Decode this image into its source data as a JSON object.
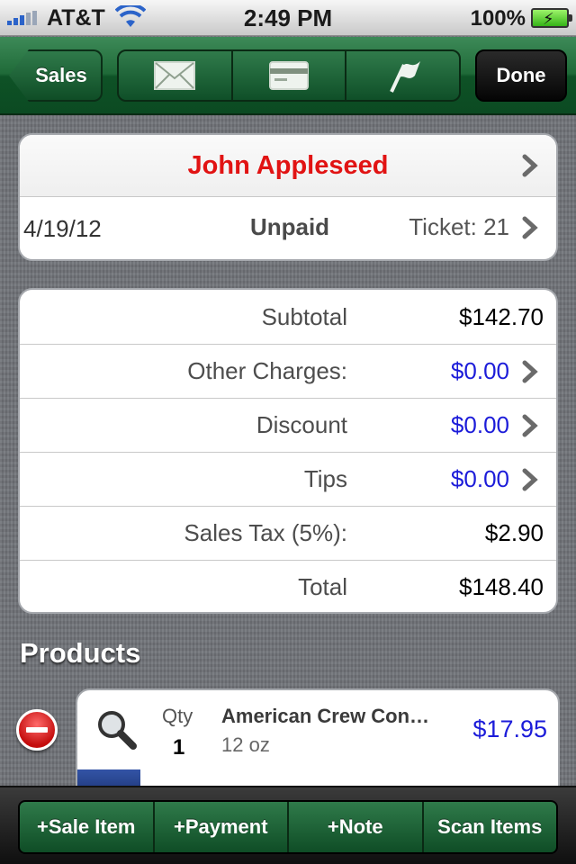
{
  "status_bar": {
    "carrier": "AT&T",
    "time": "2:49 PM",
    "battery": "100%"
  },
  "toolbar": {
    "back_label": "Sales",
    "actions": [
      "mail-icon",
      "card-icon",
      "flag-icon"
    ],
    "done_label": "Done"
  },
  "ticket": {
    "customer": "John Appleseed",
    "date": "4/19/12",
    "status": "Unpaid",
    "ticket": "Ticket: 21"
  },
  "totals": [
    {
      "label": "Subtotal",
      "value": "$142.70",
      "link": false
    },
    {
      "label": "Other Charges:",
      "value": "$0.00",
      "link": true
    },
    {
      "label": "Discount",
      "value": "$0.00",
      "link": true
    },
    {
      "label": "Tips",
      "value": "$0.00",
      "link": true
    },
    {
      "label": "Sales Tax (5%):",
      "value": "$2.90",
      "link": false
    },
    {
      "label": "Total",
      "value": "$148.40",
      "link": false
    }
  ],
  "products": {
    "title": "Products",
    "qty_label": "Qty",
    "items": [
      {
        "qty": "1",
        "name": "American Crew Con…",
        "size": "12 oz",
        "price": "$17.95"
      }
    ]
  },
  "bottom_bar": {
    "buttons": [
      "+Sale Item",
      "+Payment",
      "+Note",
      "Scan Items"
    ]
  },
  "colors": {
    "toolbar_green": "#1f6a38",
    "customer_red": "#e11313",
    "link_blue": "#1c1cd9"
  }
}
